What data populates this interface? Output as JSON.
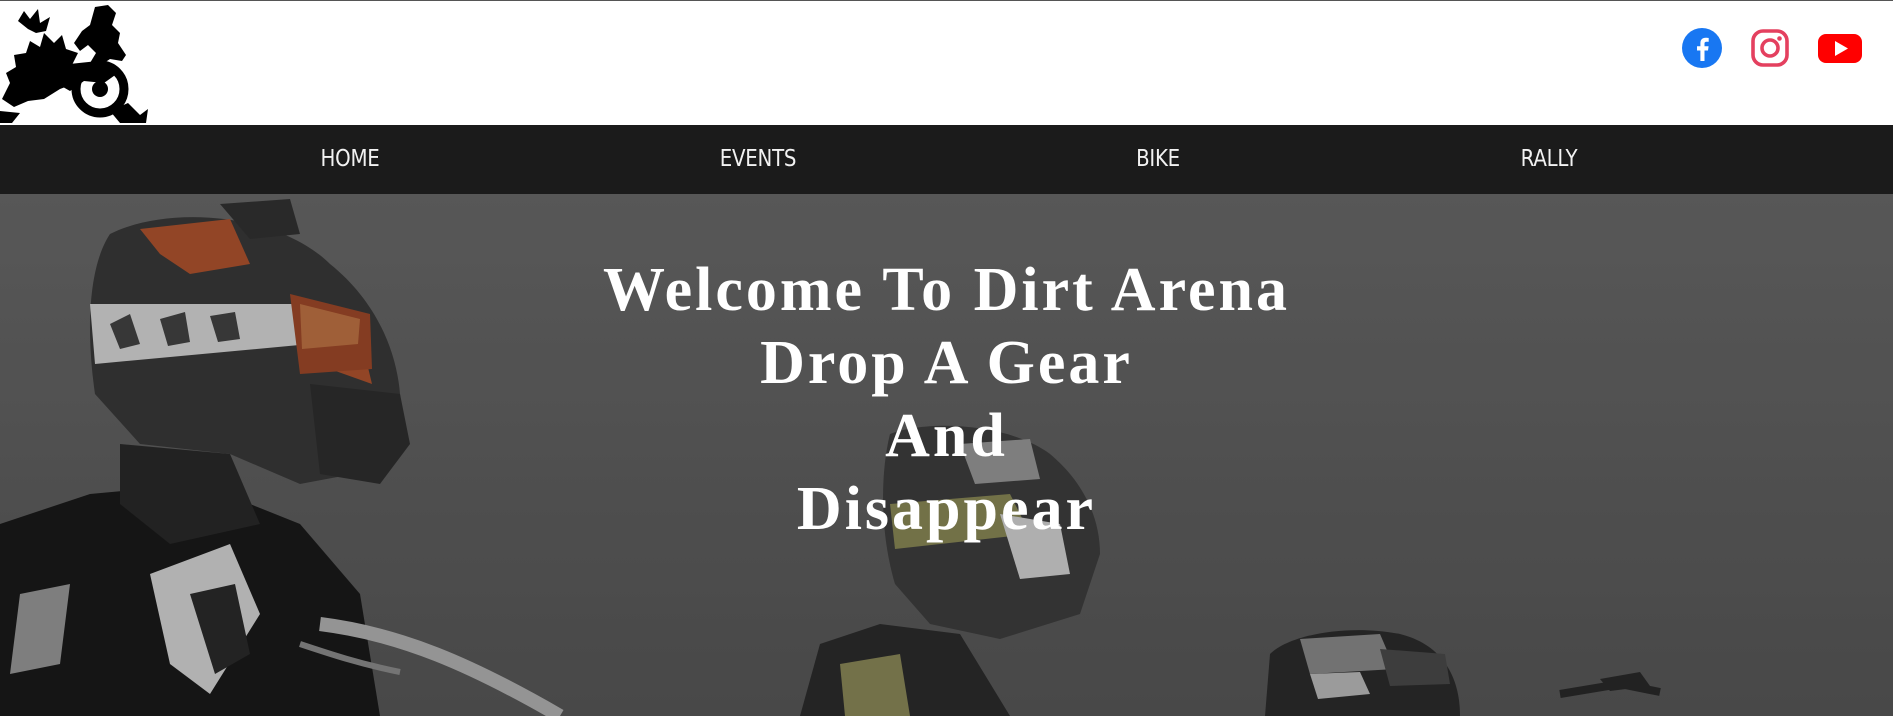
{
  "brand": {
    "logo_icon": "dirt-bike-rider-logo"
  },
  "socials": [
    {
      "name": "facebook",
      "icon": "facebook-icon",
      "color": "#1877f2"
    },
    {
      "name": "instagram",
      "icon": "instagram-icon",
      "color": "#e4405f"
    },
    {
      "name": "youtube",
      "icon": "youtube-icon",
      "color": "#ff0000"
    }
  ],
  "nav": {
    "items": [
      {
        "label": "HOME"
      },
      {
        "label": "EVENTS"
      },
      {
        "label": "BIKE"
      },
      {
        "label": "RALLY"
      }
    ]
  },
  "hero": {
    "lines": [
      "Welcome To Dirt Arena",
      "Drop A Gear",
      "And",
      "Disappear"
    ]
  },
  "colors": {
    "nav_background": "#1b1b1b",
    "hero_overlay": "#5f5f5f",
    "text_light": "#ffffff"
  }
}
